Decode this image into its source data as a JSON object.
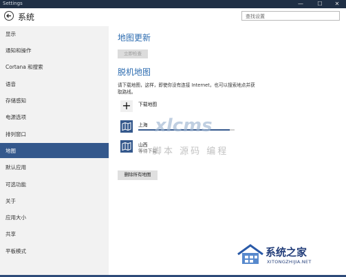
{
  "window": {
    "title": "Settings",
    "minimize_glyph": "—",
    "maximize_glyph": "☐",
    "close_glyph": "✕"
  },
  "header": {
    "title": "系统",
    "search_placeholder": "查找设置"
  },
  "sidebar": {
    "items": [
      {
        "label": "显示"
      },
      {
        "label": "通知和操作"
      },
      {
        "label": "Cortana 和搜索"
      },
      {
        "label": "语音"
      },
      {
        "label": "存储感知"
      },
      {
        "label": "电源选项"
      },
      {
        "label": "排列窗口"
      },
      {
        "label": "地图",
        "active": true
      },
      {
        "label": "默认应用"
      },
      {
        "label": "可选功能"
      },
      {
        "label": "关于"
      },
      {
        "label": "应用大小"
      },
      {
        "label": "共享"
      },
      {
        "label": "平板模式"
      }
    ]
  },
  "main": {
    "map_update_title": "地图更新",
    "check_now": "立即检查",
    "offline_title": "脱机地图",
    "offline_desc_1": "请下载地图，这样，即使你没有连接 Internet，也可以搜索地点并获",
    "offline_desc_2": "取路线。",
    "download_label": "下载地图",
    "maps": [
      {
        "name": "上海",
        "status": "",
        "progress": 0.95
      },
      {
        "name": "山西",
        "status": "等待下载"
      }
    ],
    "delete_all": "删除所有地图"
  },
  "watermark": {
    "brand": "xlcms",
    "slogan": "脚本 源码 编程",
    "site_name": "系统之家",
    "site_url": "XITONGZHIJIA.NET"
  },
  "colors": {
    "accent": "#34588c",
    "heading": "#2d6cb0",
    "titlebar": "#1f2f45"
  }
}
